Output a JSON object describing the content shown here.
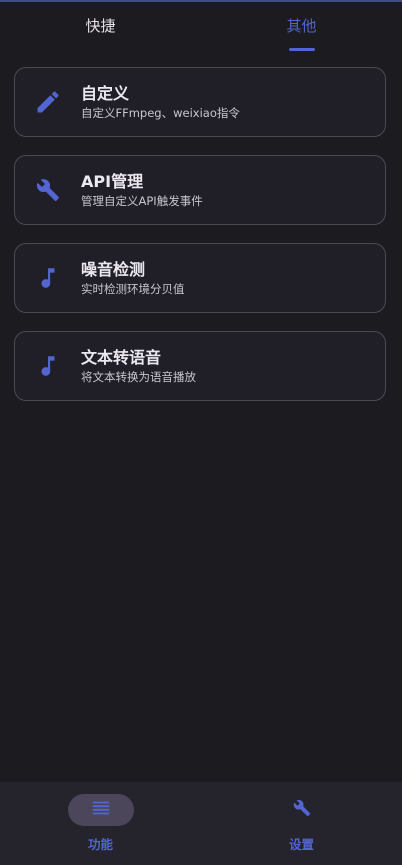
{
  "tabs": [
    {
      "label": "快捷",
      "active": false
    },
    {
      "label": "其他",
      "active": true
    }
  ],
  "cards": [
    {
      "icon": "pencil-icon",
      "title": "自定义",
      "subtitle": "自定义FFmpeg、weixiao指令"
    },
    {
      "icon": "wrench-icon",
      "title": "API管理",
      "subtitle": "管理自定义API触发事件"
    },
    {
      "icon": "music-note-icon",
      "title": "噪音检测",
      "subtitle": "实时检测环境分贝值"
    },
    {
      "icon": "music-note-icon",
      "title": "文本转语音",
      "subtitle": "将文本转换为语音播放"
    }
  ],
  "bottom_nav": [
    {
      "icon": "menu-icon",
      "label": "功能",
      "active": true
    },
    {
      "icon": "wrench-icon",
      "label": "设置",
      "active": false
    }
  ],
  "colors": {
    "accent": "#5265d0",
    "background": "#1c1b1f",
    "card_background": "#201f28",
    "card_border": "#4a4a55",
    "nav_background": "#25232c",
    "nav_pill": "#4b4659"
  }
}
